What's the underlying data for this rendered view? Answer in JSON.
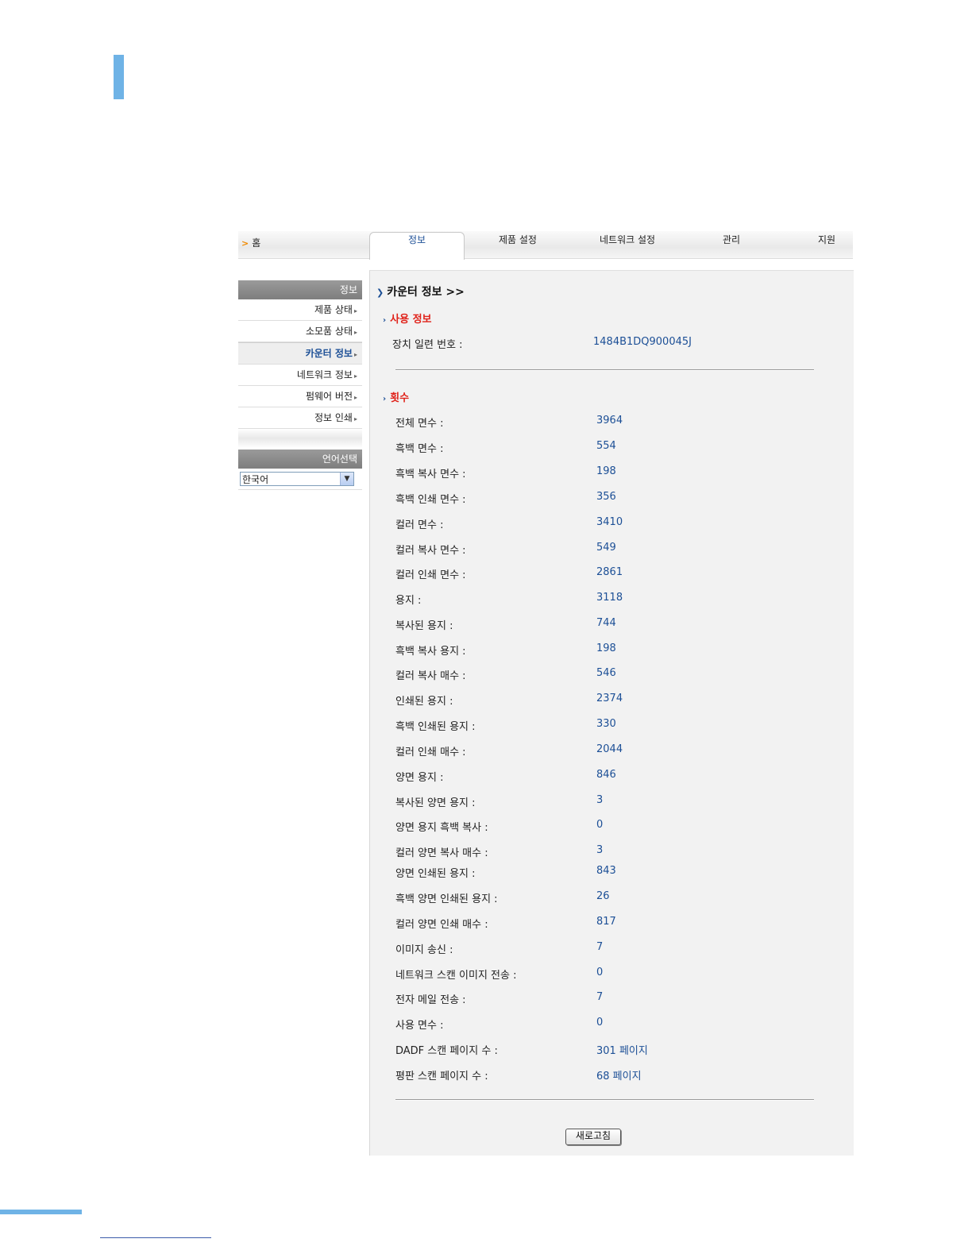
{
  "nav": {
    "home": "홈",
    "tabs": [
      "정보",
      "제품 설정",
      "네트워크 설정",
      "관리",
      "지원"
    ]
  },
  "sidebar": {
    "header": "정보",
    "items": [
      "제품 상태",
      "소모품 상태",
      "카운터 정보",
      "네트워크 정보",
      "펌웨어 버전",
      "정보 인쇄"
    ],
    "active_index": 2,
    "language_header": "언어선택",
    "language_value": "한국어"
  },
  "content": {
    "title": "카운터 정보 >>",
    "usage_section": "사용 정보",
    "serial_label": "장치 일련 번호 :",
    "serial_value": "1484B1DQ900045J",
    "count_section": "횟수",
    "rows": [
      {
        "label": "전체 면수  :",
        "value": "3964"
      },
      {
        "label": "흑백 면수  :",
        "value": "554"
      },
      {
        "label": "흑백 복사 면수  :",
        "value": "198"
      },
      {
        "label": "흑백 인쇄 면수  :",
        "value": "356"
      },
      {
        "label": "컬러 면수  :",
        "value": "3410"
      },
      {
        "label": "컬러 복사 면수  :",
        "value": "549"
      },
      {
        "label": "컬러 인쇄 면수  :",
        "value": "2861"
      },
      {
        "label": "용지  :",
        "value": "3118"
      },
      {
        "label": "복사된 용지  :",
        "value": "744"
      },
      {
        "label": "흑백 복사 용지  :",
        "value": "198"
      },
      {
        "label": "컬러 복사 매수  :",
        "value": "546"
      },
      {
        "label": "인쇄된 용지  :",
        "value": "2374"
      },
      {
        "label": "흑백 인쇄된 용지  :",
        "value": "330"
      },
      {
        "label": "컬러 인쇄 매수  :",
        "value": "2044"
      },
      {
        "label": "양면 용지  :",
        "value": "846"
      },
      {
        "label": "복사된 양면 용지  :",
        "value": "3"
      },
      {
        "label": "양면 용지 흑백 복사  :",
        "value": "0"
      },
      {
        "label": "컬러 양면 복사 매수  :",
        "value": "3"
      },
      {
        "label": "양면 인쇄된 용지  :",
        "value": "843"
      },
      {
        "label": "흑백 양면 인쇄된 용지  :",
        "value": "26"
      },
      {
        "label": "컬러 양면 인쇄 매수  :",
        "value": "817"
      },
      {
        "label": "이미지 송신 :",
        "value": "7"
      },
      {
        "label": "네트워크 스캔 이미지 전송 :",
        "value": "0"
      },
      {
        "label": "전자 메일 전송 :",
        "value": "7"
      },
      {
        "label": "사용 면수  :",
        "value": "0"
      },
      {
        "label": "DADF 스캔 페이지 수 :",
        "value": "301 페이지"
      },
      {
        "label": "평판 스캔 페이지 수 :",
        "value": "68 페이지"
      }
    ],
    "refresh_button": "새로고침"
  },
  "colors": {
    "accent_blue": "#6fb3e6",
    "link_blue": "#1c4f96",
    "section_red": "#e0231b"
  }
}
